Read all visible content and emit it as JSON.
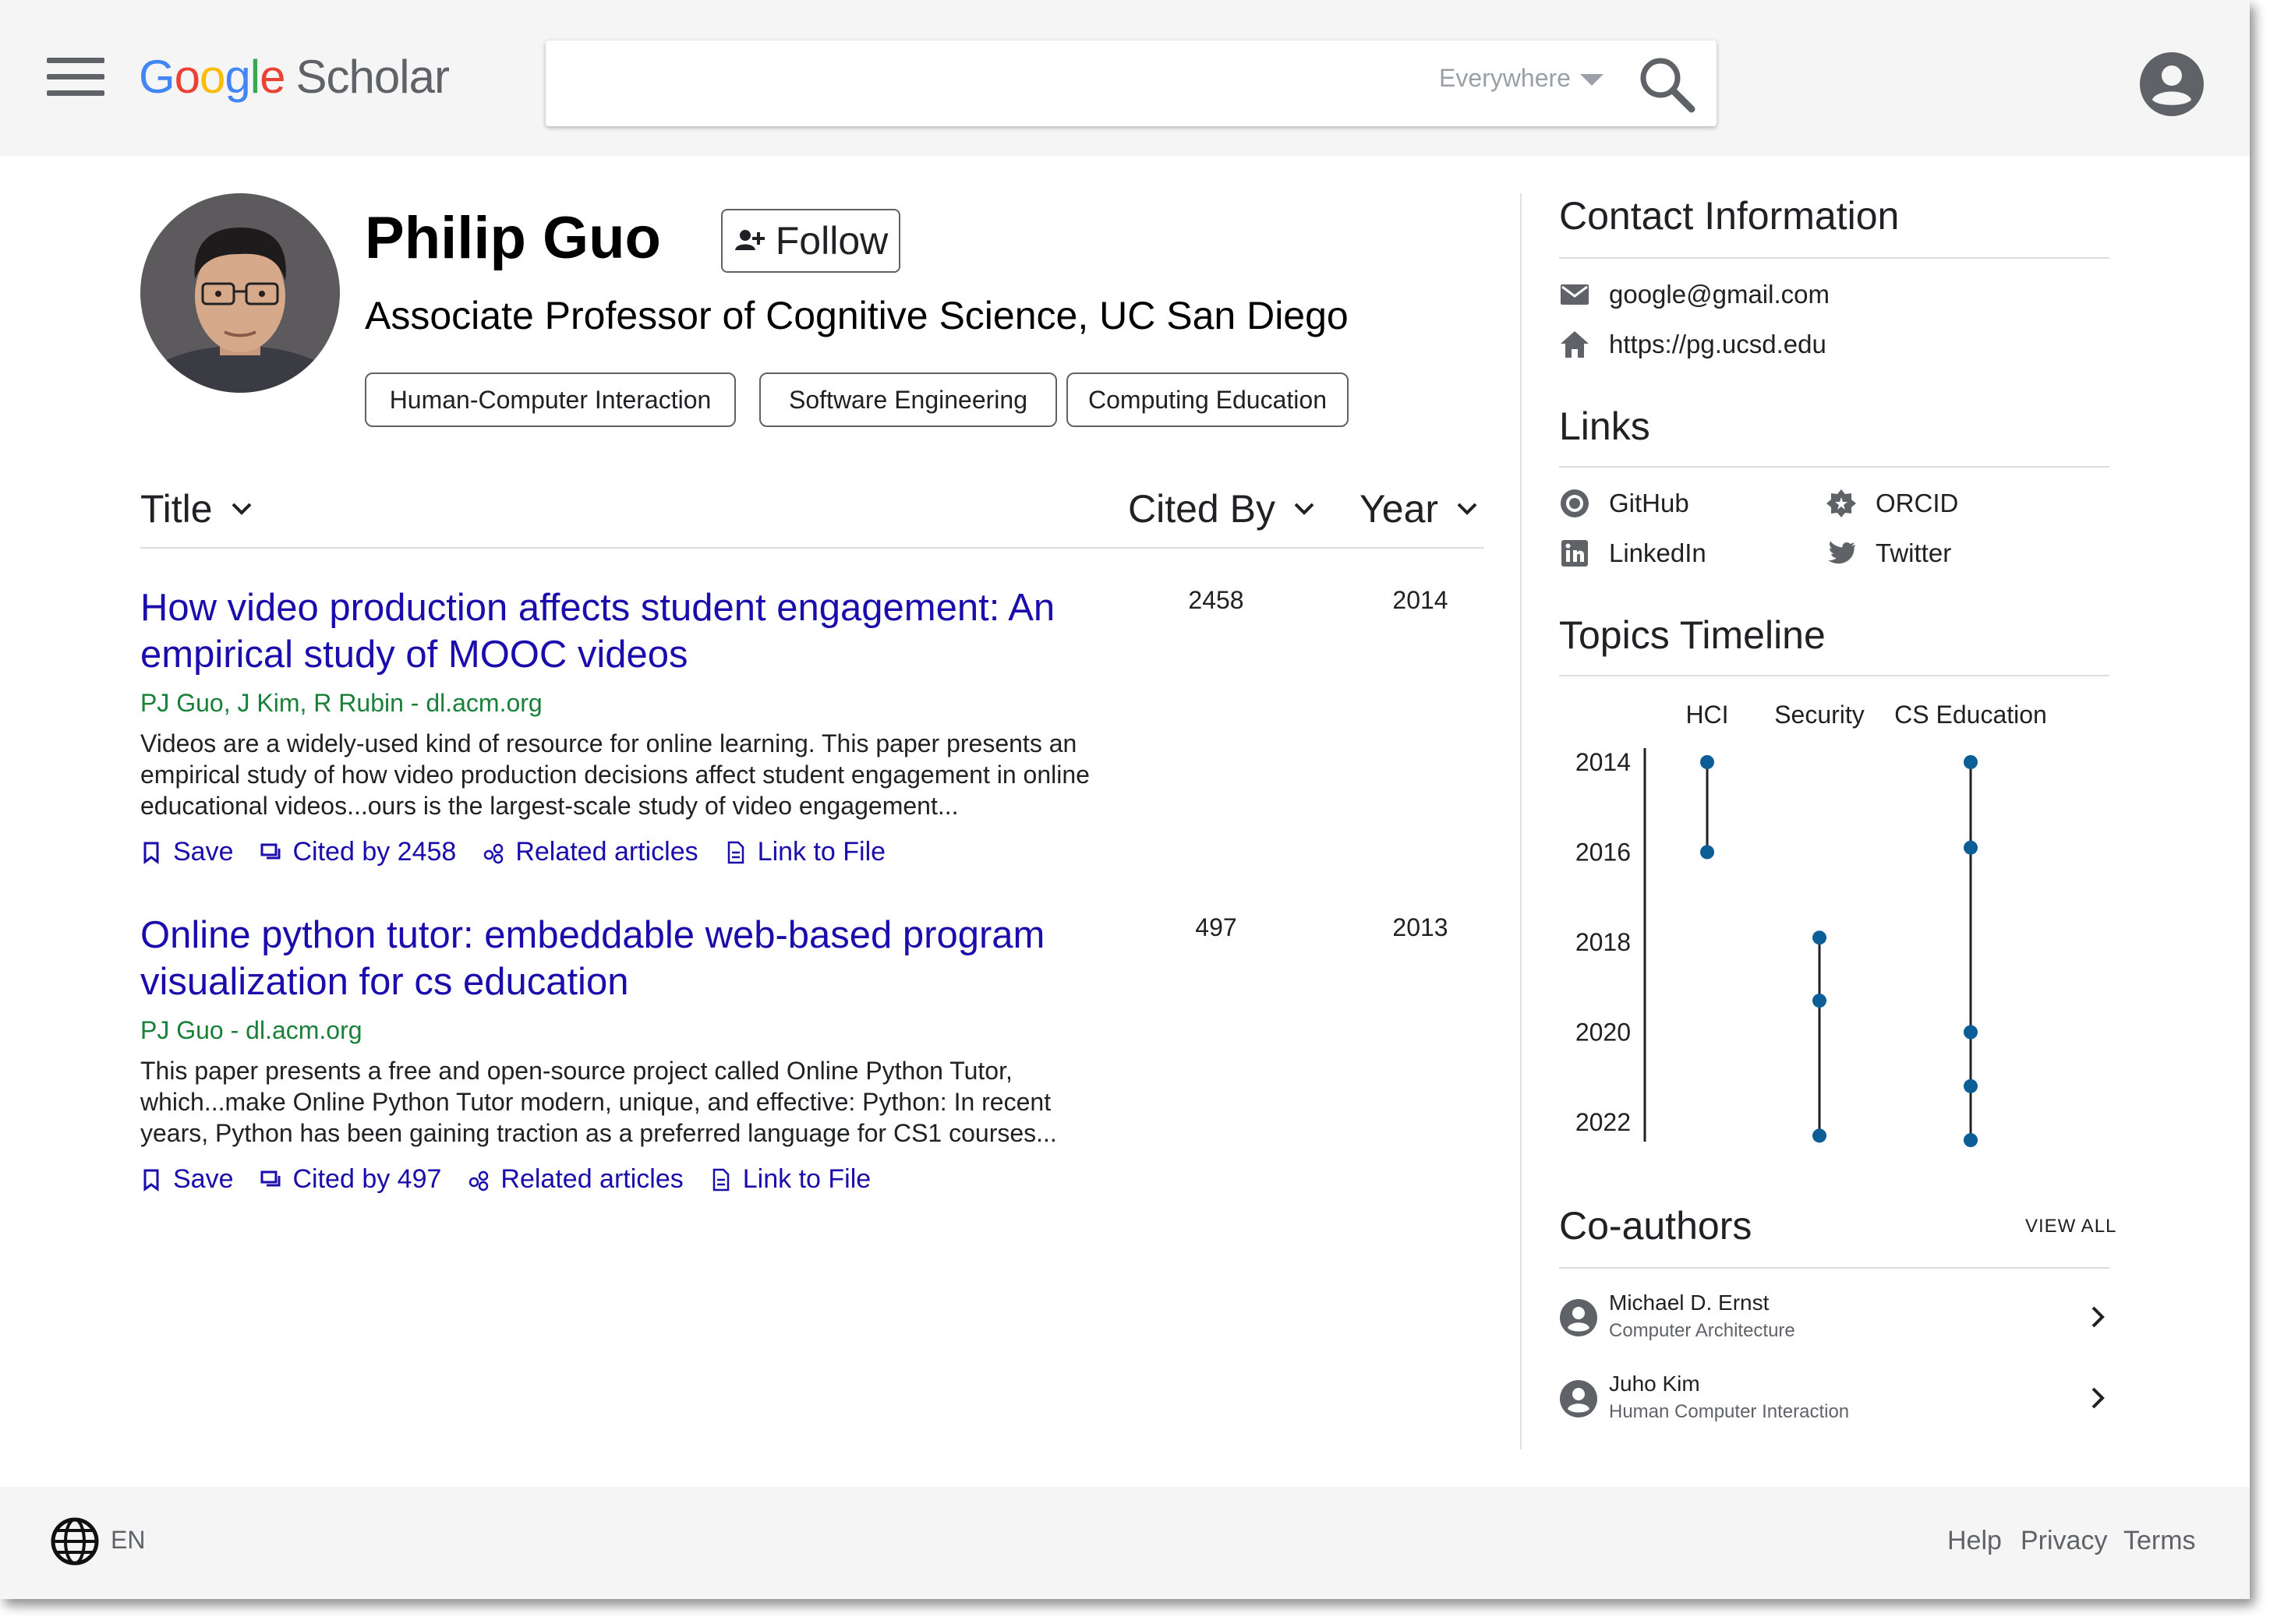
{
  "header": {
    "logo_parts": [
      "G",
      "o",
      "o",
      "g",
      "l",
      "e"
    ],
    "logo_product": "Scholar",
    "search_placeholder": "",
    "scope": "Everywhere"
  },
  "profile": {
    "name": "Philip Guo",
    "follow_label": "Follow",
    "affiliation": "Associate Professor of Cognitive Science, UC San Diego",
    "interests": [
      "Human-Computer Interaction",
      "Software Engineering",
      "Computing Education"
    ]
  },
  "table": {
    "col_title": "Title",
    "col_cited": "Cited By",
    "col_year": "Year"
  },
  "publications": [
    {
      "title": "How video production affects student engagement: An empirical study of MOOC videos",
      "authors": "PJ Guo, J Kim, R Rubin - dl.acm.org",
      "snippet": "Videos are a widely-used kind of resource for online learning. This paper presents an empirical study of how video production decisions affect student engagement in online educational videos...ours is the largest-scale study of video engagement...",
      "cited_by": "2458",
      "year": "2014",
      "actions": {
        "save": "Save",
        "cited": "Cited by 2458",
        "related": "Related articles",
        "file": "Link to File"
      }
    },
    {
      "title": "Online python tutor: embeddable web-based program visualization for cs education",
      "authors": "PJ Guo - dl.acm.org",
      "snippet": "This paper presents a free and open-source project called Online Python Tutor, which...make Online Python Tutor modern, unique, and effective: Python: In recent years, Python has been gaining traction as a preferred language for CS1 courses...",
      "cited_by": "497",
      "year": "2013",
      "actions": {
        "save": "Save",
        "cited": "Cited by 497",
        "related": "Related articles",
        "file": "Link to File"
      }
    }
  ],
  "sidebar": {
    "contact_heading": "Contact Information",
    "email": "google@gmail.com",
    "homepage": "https://pg.ucsd.edu",
    "links_heading": "Links",
    "links": [
      "GitHub",
      "ORCID",
      "LinkedIn",
      "Twitter"
    ],
    "timeline_heading": "Topics Timeline",
    "coauthors_heading": "Co-authors",
    "view_all": "VIEW ALL",
    "coauthors": [
      {
        "name": "Michael D. Ernst",
        "field": "Computer Architecture"
      },
      {
        "name": "Juho Kim",
        "field": "Human Computer Interaction"
      }
    ]
  },
  "timeline": {
    "topics": [
      "HCI",
      "Security",
      "CS Education"
    ],
    "year_ticks": [
      "2014",
      "2016",
      "2018",
      "2020",
      "2022"
    ],
    "year_range": [
      2014,
      2022
    ],
    "color": "#0b5e96",
    "points": [
      {
        "topic": "HCI",
        "years": [
          2014,
          2016
        ]
      },
      {
        "topic": "Security",
        "years": [
          2017.9,
          2019.3,
          2022.3
        ]
      },
      {
        "topic": "CS Education",
        "years": [
          2014,
          2015.9,
          2020,
          2021.2,
          2022.4
        ]
      }
    ]
  },
  "footer": {
    "language": "EN",
    "links": [
      "Help",
      "Privacy",
      "Terms"
    ]
  },
  "colors": {
    "link": "#1a0dab",
    "authors": "#188038",
    "timeline": "#0b5e96"
  }
}
